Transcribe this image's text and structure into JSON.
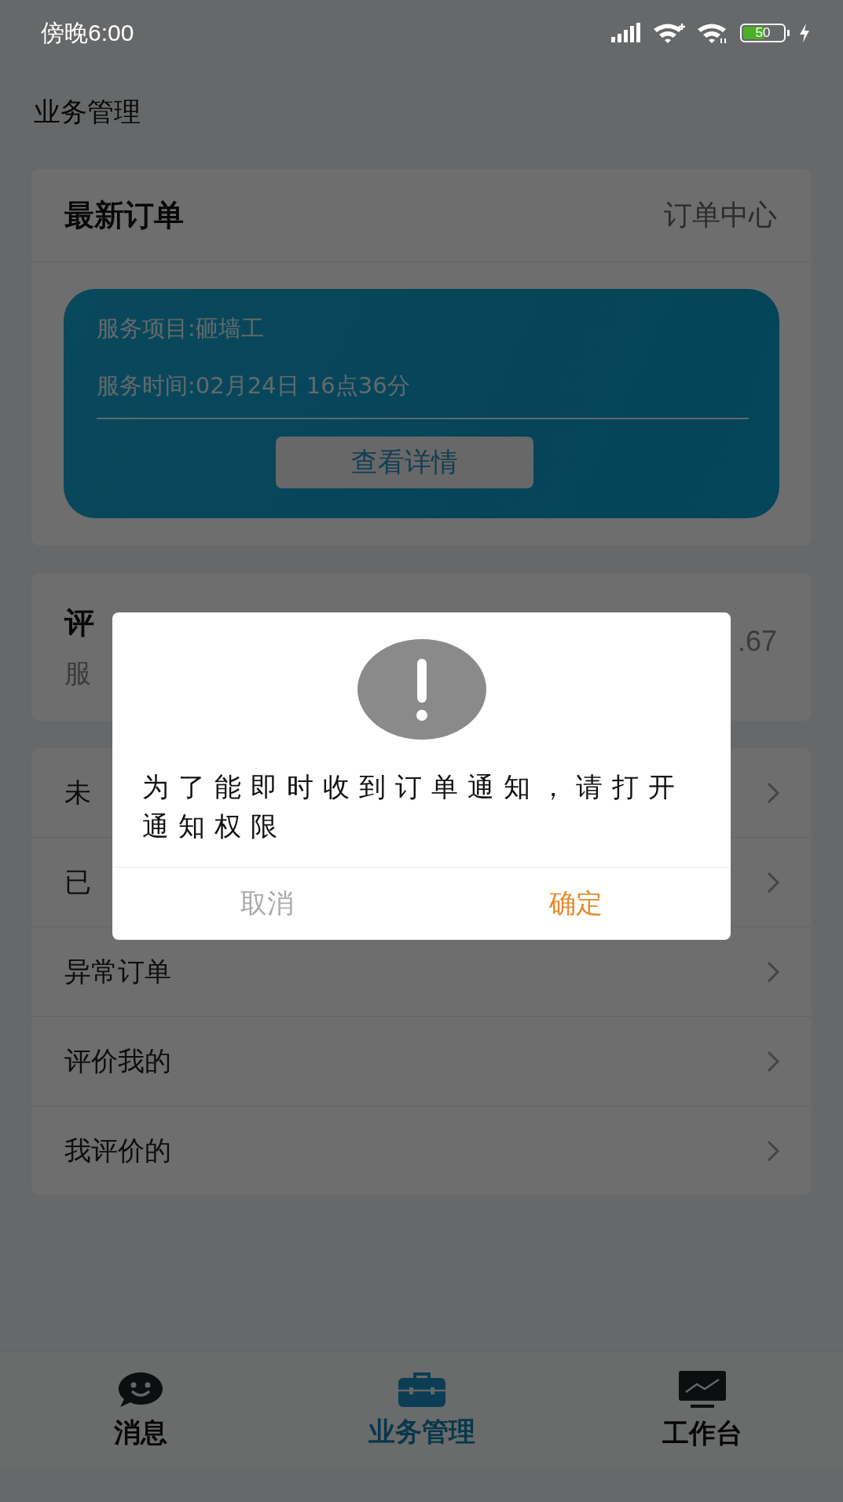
{
  "status_bar": {
    "time": "傍晚6:00",
    "battery": "50"
  },
  "page_title": "业务管理",
  "latest_order": {
    "title": "最新订单",
    "link": "订单中心",
    "service_item": "服务项目:砸墙工",
    "service_time": "服务时间:02月24日 16点36分",
    "button": "查看详情"
  },
  "review_card": {
    "title": "评",
    "subtitle": "服",
    "score": ".67"
  },
  "menu": [
    {
      "label": "未"
    },
    {
      "label": "已"
    },
    {
      "label": "异常订单"
    },
    {
      "label": "评价我的"
    },
    {
      "label": "我评价的"
    }
  ],
  "tabs": [
    {
      "label": "消息",
      "selected": false
    },
    {
      "label": "业务管理",
      "selected": true
    },
    {
      "label": "工作台",
      "selected": false
    }
  ],
  "dialog": {
    "message": "为了能即时收到订单通知，请打开通知权限",
    "cancel": "取消",
    "confirm": "确定"
  }
}
